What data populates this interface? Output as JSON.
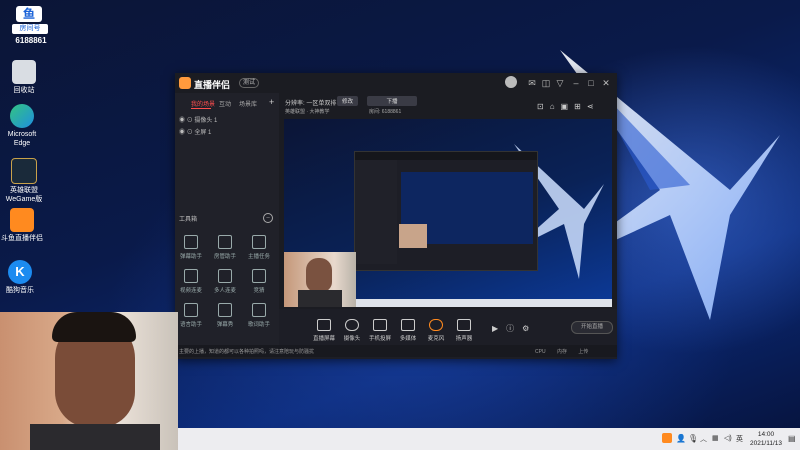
{
  "desktop": {
    "corner_logo": {
      "badge": "房间号",
      "number": "6188861"
    },
    "icons": [
      {
        "label": "回收站",
        "icon": "recycle-bin-icon"
      },
      {
        "label": "Microsoft Edge",
        "icon": "edge-icon"
      },
      {
        "label": "英雄联盟 WeGame版",
        "icon": "league-icon"
      },
      {
        "label": "斗鱼直播伴侣",
        "icon": "douyu-icon"
      },
      {
        "label": "酷狗音乐",
        "icon": "kugou-icon"
      }
    ]
  },
  "app": {
    "title": "直播伴侣",
    "version_badge": "测试",
    "left_tabs": [
      "我的场景",
      "互动",
      "场景库"
    ],
    "add_label": "+",
    "scenes": [
      {
        "label": "摄像头 1"
      },
      {
        "label": "全屏 1"
      }
    ],
    "tools_title": "工具箱",
    "tools": [
      {
        "label": "弹幕助手"
      },
      {
        "label": "房管助手"
      },
      {
        "label": "主播任务"
      },
      {
        "label": "视频连麦"
      },
      {
        "label": "多人连麦"
      },
      {
        "label": "竞猜"
      },
      {
        "label": "语言助手"
      },
      {
        "label": "弹幕秀"
      },
      {
        "label": "歌词助手"
      }
    ],
    "preview": {
      "mode_label": "分辨率",
      "mode_value": "一区单双排",
      "mode_btn": "修改",
      "stream_btn": "下播",
      "room_label": "英雄联盟 · 大神教学",
      "room_no_label": "房间: 6188861",
      "top_icons": [
        "camera-icon",
        "lock-icon",
        "layout-icon",
        "record-icon",
        "share-icon"
      ]
    },
    "bottom_buttons": [
      {
        "label": "直播屏幕"
      },
      {
        "label": "摄像头"
      },
      {
        "label": "手机投屏"
      },
      {
        "label": "多媒体"
      },
      {
        "label": "麦克风"
      },
      {
        "label": "扬声器"
      }
    ],
    "start_button": "开始直播",
    "status_text": "主要的上播，知道的都可以各种拍照吗，请注意陪玩与防骚扰",
    "status_metrics": [
      "CPU",
      "内存",
      "上传"
    ]
  },
  "taskbar": {
    "time": "14:00",
    "date": "2021/11/13",
    "tray_ime": "英"
  }
}
